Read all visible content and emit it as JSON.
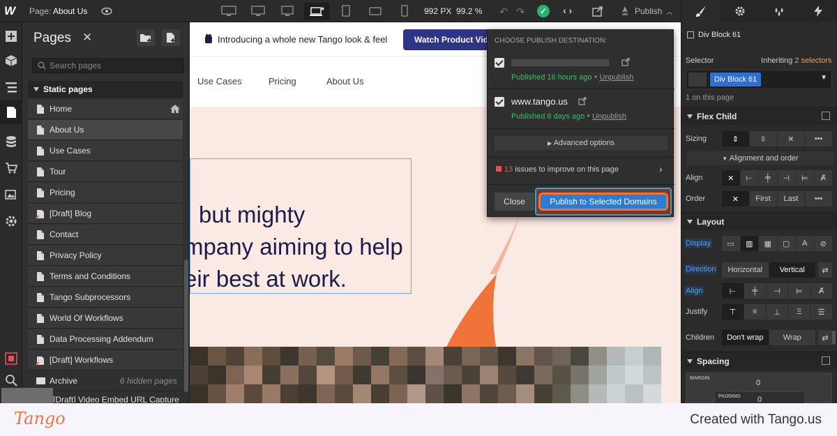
{
  "topbar": {
    "page_prefix": "Page:",
    "page_name": "About Us",
    "width_px": "992 PX",
    "zoom": "99.2 %",
    "publish_label": "Publish"
  },
  "pages_panel": {
    "title": "Pages",
    "search_placeholder": "Search pages",
    "section": "Static pages",
    "items": [
      {
        "label": "Home",
        "type": "page",
        "home": true
      },
      {
        "label": "About Us",
        "type": "page",
        "selected": true
      },
      {
        "label": "Use Cases",
        "type": "page"
      },
      {
        "label": "Tour",
        "type": "page"
      },
      {
        "label": "Pricing",
        "type": "page"
      },
      {
        "label": "[Draft] Blog",
        "type": "draft"
      },
      {
        "label": "Contact",
        "type": "page"
      },
      {
        "label": "Privacy Policy",
        "type": "page"
      },
      {
        "label": "Terms and Conditions",
        "type": "page"
      },
      {
        "label": "Tango Subprocessors",
        "type": "page"
      },
      {
        "label": "World Of Workflows",
        "type": "page"
      },
      {
        "label": "Data Processing Addendum",
        "type": "page"
      },
      {
        "label": "[Draft] Workflows",
        "type": "draft"
      },
      {
        "label": "Archive",
        "type": "folder",
        "note": "6 hidden pages"
      },
      {
        "label": "[Draft] Video Embed URL Capture",
        "type": "draft"
      }
    ]
  },
  "canvas": {
    "banner_text": "Introducing a whole new Tango look & feel",
    "banner_button": "Watch Product Video",
    "nav": [
      "Use Cases",
      "Pricing",
      "About Us"
    ],
    "hero_lines": [
      "but mighty",
      "mpany aiming to help",
      "eir best at work."
    ]
  },
  "publish_popup": {
    "title": "CHOOSE PUBLISH DESTINATION:",
    "destinations": [
      {
        "domain": "",
        "status": "Published 16 hours ago",
        "action": "Unpublish"
      },
      {
        "domain": "www.tango.us",
        "status": "Published 8 days ago",
        "action": "Unpublish"
      }
    ],
    "advanced": "Advanced options",
    "issues_count": "13",
    "issues_text": "issues to improve on this page",
    "close": "Close",
    "publish_selected": "Publish to Selected Domains"
  },
  "right_panel": {
    "element_name": "Div Block 61",
    "selector_label": "Selector",
    "inheriting": "Inheriting",
    "selectors_count": "2 selectors",
    "selector_chip": "Div Block 61",
    "on_page": "1 on this page",
    "flex_child": "Flex Child",
    "sizing": "Sizing",
    "alignment_order": "Alignment and order",
    "align": "Align",
    "order": "Order",
    "order_first": "First",
    "order_last": "Last",
    "layout": "Layout",
    "display": "Display",
    "direction": "Direction",
    "dir_horizontal": "Horizontal",
    "dir_vertical": "Vertical",
    "align2": "Align",
    "justify": "Justify",
    "children": "Children",
    "dont_wrap": "Don't wrap",
    "wrap": "Wrap",
    "spacing": "Spacing",
    "margin_label": "MARGIN",
    "margin_value": "0",
    "padding_label": "PADDING",
    "padding_value": "0"
  },
  "footer": {
    "logo": "Tango",
    "created": "Created with Tango.us"
  },
  "colors": {
    "accent_orange": "#f0733a",
    "publish_blue": "#2c7bd6",
    "green": "#3ebc6a",
    "issue_red": "#ef4a5a"
  }
}
